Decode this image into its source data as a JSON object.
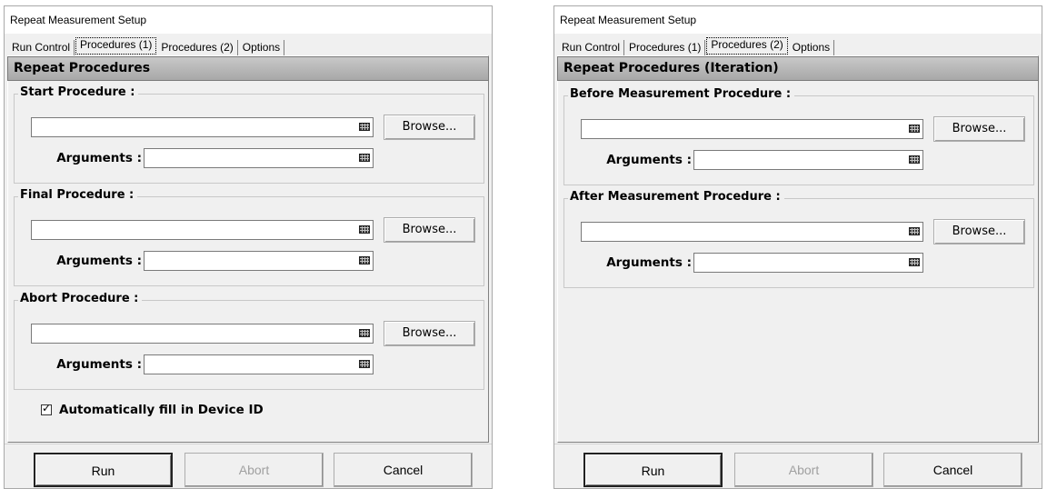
{
  "dialogs": [
    {
      "title": "Repeat Measurement Setup",
      "tabs": [
        "Run Control",
        "Procedures (1)",
        "Procedures (2)",
        "Options"
      ],
      "active_tab": 1,
      "header": "Repeat Procedures",
      "groups": [
        {
          "title": "Start Procedure :",
          "path_value": "",
          "browse_label": "Browse...",
          "arguments_label": "Arguments :",
          "arguments_value": ""
        },
        {
          "title": "Final Procedure :",
          "path_value": "",
          "browse_label": "Browse...",
          "arguments_label": "Arguments :",
          "arguments_value": ""
        },
        {
          "title": "Abort Procedure :",
          "path_value": "",
          "browse_label": "Browse...",
          "arguments_label": "Arguments :",
          "arguments_value": ""
        }
      ],
      "checkbox": {
        "label": "Automatically fill in Device ID",
        "checked": true
      },
      "buttons": {
        "run": "Run",
        "abort": "Abort",
        "cancel": "Cancel"
      }
    },
    {
      "title": "Repeat Measurement Setup",
      "tabs": [
        "Run Control",
        "Procedures (1)",
        "Procedures (2)",
        "Options"
      ],
      "active_tab": 2,
      "header": "Repeat Procedures (Iteration)",
      "groups": [
        {
          "title": "Before Measurement Procedure :",
          "path_value": "",
          "browse_label": "Browse...",
          "arguments_label": "Arguments :",
          "arguments_value": ""
        },
        {
          "title": "After Measurement Procedure :",
          "path_value": "",
          "browse_label": "Browse...",
          "arguments_label": "Arguments :",
          "arguments_value": ""
        }
      ],
      "buttons": {
        "run": "Run",
        "abort": "Abort",
        "cancel": "Cancel"
      }
    }
  ]
}
